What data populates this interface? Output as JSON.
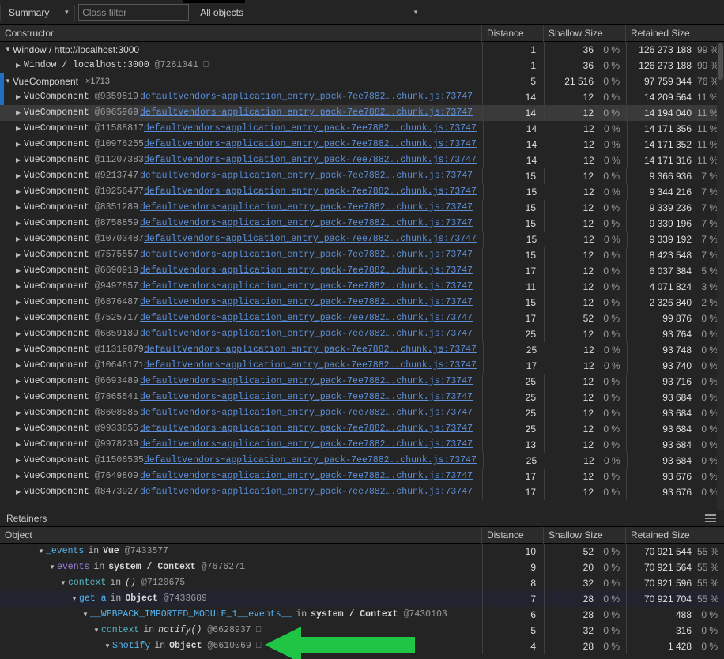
{
  "toolbar": {
    "view_select": "Summary",
    "view_caret": "chevron-down",
    "class_filter_placeholder": "Class filter",
    "class_filter_value": "",
    "objects_select": "All objects",
    "objects_caret": "chevron-down"
  },
  "constructors_panel": {
    "columns": [
      "Constructor",
      "Distance",
      "Shallow Size",
      "Retained Size"
    ],
    "rows": [
      {
        "indent": 0,
        "tri": "open",
        "font": "sans",
        "name": "Window / http://localhost:3000",
        "at": "",
        "count": "",
        "link": "",
        "empty": false,
        "distance": "1",
        "shallow": "36",
        "shallow_pct": "0 %",
        "retained": "126 273 188",
        "retained_pct": "99 %",
        "state": ""
      },
      {
        "indent": 1,
        "tri": "closed",
        "font": "mono",
        "name": "Window / localhost:3000",
        "at": "@7261041",
        "count": "",
        "link": "",
        "empty": true,
        "distance": "1",
        "shallow": "36",
        "shallow_pct": "0 %",
        "retained": "126 273 188",
        "retained_pct": "99 %",
        "state": ""
      },
      {
        "indent": 0,
        "tri": "open",
        "font": "sans",
        "name": "VueComponent",
        "at": "",
        "count": "×1713",
        "link": "",
        "empty": false,
        "distance": "5",
        "shallow": "21 516",
        "shallow_pct": "0 %",
        "retained": "97 759 344",
        "retained_pct": "76 %",
        "state": ""
      },
      {
        "indent": 1,
        "tri": "closed",
        "font": "mono",
        "name": "VueComponent",
        "at": "@9359819",
        "count": "",
        "link": "defaultVendors~application_entry_pack-7ee7882….chunk.js:73747",
        "empty": false,
        "distance": "14",
        "shallow": "12",
        "shallow_pct": "0 %",
        "retained": "14 209 564",
        "retained_pct": "11 %",
        "state": ""
      },
      {
        "indent": 1,
        "tri": "closed",
        "font": "mono",
        "name": "VueComponent",
        "at": "@6965969",
        "count": "",
        "link": "defaultVendors~application_entry_pack-7ee7882….chunk.js:73747",
        "empty": false,
        "distance": "14",
        "shallow": "12",
        "shallow_pct": "0 %",
        "retained": "14 194 040",
        "retained_pct": "11 %",
        "state": "sel-gray"
      },
      {
        "indent": 1,
        "tri": "closed",
        "font": "mono",
        "name": "VueComponent",
        "at": "@11588817",
        "count": "",
        "link": "defaultVendors~application_entry_pack-7ee7882….chunk.js:73747",
        "empty": false,
        "distance": "14",
        "shallow": "12",
        "shallow_pct": "0 %",
        "retained": "14 171 356",
        "retained_pct": "11 %",
        "state": ""
      },
      {
        "indent": 1,
        "tri": "closed",
        "font": "mono",
        "name": "VueComponent",
        "at": "@10976255",
        "count": "",
        "link": "defaultVendors~application_entry_pack-7ee7882….chunk.js:73747",
        "empty": false,
        "distance": "14",
        "shallow": "12",
        "shallow_pct": "0 %",
        "retained": "14 171 352",
        "retained_pct": "11 %",
        "state": ""
      },
      {
        "indent": 1,
        "tri": "closed",
        "font": "mono",
        "name": "VueComponent",
        "at": "@11207383",
        "count": "",
        "link": "defaultVendors~application_entry_pack-7ee7882….chunk.js:73747",
        "empty": false,
        "distance": "14",
        "shallow": "12",
        "shallow_pct": "0 %",
        "retained": "14 171 316",
        "retained_pct": "11 %",
        "state": ""
      },
      {
        "indent": 1,
        "tri": "closed",
        "font": "mono",
        "name": "VueComponent",
        "at": "@9213747",
        "count": "",
        "link": "defaultVendors~application_entry_pack-7ee7882….chunk.js:73747",
        "empty": false,
        "distance": "15",
        "shallow": "12",
        "shallow_pct": "0 %",
        "retained": "9 366 936",
        "retained_pct": "7 %",
        "state": ""
      },
      {
        "indent": 1,
        "tri": "closed",
        "font": "mono",
        "name": "VueComponent",
        "at": "@10256477",
        "count": "",
        "link": "defaultVendors~application_entry_pack-7ee7882….chunk.js:73747",
        "empty": false,
        "distance": "15",
        "shallow": "12",
        "shallow_pct": "0 %",
        "retained": "9 344 216",
        "retained_pct": "7 %",
        "state": ""
      },
      {
        "indent": 1,
        "tri": "closed",
        "font": "mono",
        "name": "VueComponent",
        "at": "@8351289",
        "count": "",
        "link": "defaultVendors~application_entry_pack-7ee7882….chunk.js:73747",
        "empty": false,
        "distance": "15",
        "shallow": "12",
        "shallow_pct": "0 %",
        "retained": "9 339 236",
        "retained_pct": "7 %",
        "state": ""
      },
      {
        "indent": 1,
        "tri": "closed",
        "font": "mono",
        "name": "VueComponent",
        "at": "@8758859",
        "count": "",
        "link": "defaultVendors~application_entry_pack-7ee7882….chunk.js:73747",
        "empty": false,
        "distance": "15",
        "shallow": "12",
        "shallow_pct": "0 %",
        "retained": "9 339 196",
        "retained_pct": "7 %",
        "state": ""
      },
      {
        "indent": 1,
        "tri": "closed",
        "font": "mono",
        "name": "VueComponent",
        "at": "@10703487",
        "count": "",
        "link": "defaultVendors~application_entry_pack-7ee7882….chunk.js:73747",
        "empty": false,
        "distance": "15",
        "shallow": "12",
        "shallow_pct": "0 %",
        "retained": "9 339 192",
        "retained_pct": "7 %",
        "state": ""
      },
      {
        "indent": 1,
        "tri": "closed",
        "font": "mono",
        "name": "VueComponent",
        "at": "@7575557",
        "count": "",
        "link": "defaultVendors~application_entry_pack-7ee7882….chunk.js:73747",
        "empty": false,
        "distance": "15",
        "shallow": "12",
        "shallow_pct": "0 %",
        "retained": "8 423 548",
        "retained_pct": "7 %",
        "state": ""
      },
      {
        "indent": 1,
        "tri": "closed",
        "font": "mono",
        "name": "VueComponent",
        "at": "@6690919",
        "count": "",
        "link": "defaultVendors~application_entry_pack-7ee7882….chunk.js:73747",
        "empty": false,
        "distance": "17",
        "shallow": "12",
        "shallow_pct": "0 %",
        "retained": "6 037 384",
        "retained_pct": "5 %",
        "state": ""
      },
      {
        "indent": 1,
        "tri": "closed",
        "font": "mono",
        "name": "VueComponent",
        "at": "@9497857",
        "count": "",
        "link": "defaultVendors~application_entry_pack-7ee7882….chunk.js:73747",
        "empty": false,
        "distance": "11",
        "shallow": "12",
        "shallow_pct": "0 %",
        "retained": "4 071 824",
        "retained_pct": "3 %",
        "state": ""
      },
      {
        "indent": 1,
        "tri": "closed",
        "font": "mono",
        "name": "VueComponent",
        "at": "@6876487",
        "count": "",
        "link": "defaultVendors~application_entry_pack-7ee7882….chunk.js:73747",
        "empty": false,
        "distance": "15",
        "shallow": "12",
        "shallow_pct": "0 %",
        "retained": "2 326 840",
        "retained_pct": "2 %",
        "state": ""
      },
      {
        "indent": 1,
        "tri": "closed",
        "font": "mono",
        "name": "VueComponent",
        "at": "@7525717",
        "count": "",
        "link": "defaultVendors~application_entry_pack-7ee7882….chunk.js:73747",
        "empty": false,
        "distance": "17",
        "shallow": "52",
        "shallow_pct": "0 %",
        "retained": "99 876",
        "retained_pct": "0 %",
        "state": ""
      },
      {
        "indent": 1,
        "tri": "closed",
        "font": "mono",
        "name": "VueComponent",
        "at": "@6859189",
        "count": "",
        "link": "defaultVendors~application_entry_pack-7ee7882….chunk.js:73747",
        "empty": false,
        "distance": "25",
        "shallow": "12",
        "shallow_pct": "0 %",
        "retained": "93 764",
        "retained_pct": "0 %",
        "state": ""
      },
      {
        "indent": 1,
        "tri": "closed",
        "font": "mono",
        "name": "VueComponent",
        "at": "@11319879",
        "count": "",
        "link": "defaultVendors~application_entry_pack-7ee7882….chunk.js:73747",
        "empty": false,
        "distance": "25",
        "shallow": "12",
        "shallow_pct": "0 %",
        "retained": "93 748",
        "retained_pct": "0 %",
        "state": ""
      },
      {
        "indent": 1,
        "tri": "closed",
        "font": "mono",
        "name": "VueComponent",
        "at": "@10646171",
        "count": "",
        "link": "defaultVendors~application_entry_pack-7ee7882….chunk.js:73747",
        "empty": false,
        "distance": "17",
        "shallow": "12",
        "shallow_pct": "0 %",
        "retained": "93 740",
        "retained_pct": "0 %",
        "state": ""
      },
      {
        "indent": 1,
        "tri": "closed",
        "font": "mono",
        "name": "VueComponent",
        "at": "@6693489",
        "count": "",
        "link": "defaultVendors~application_entry_pack-7ee7882….chunk.js:73747",
        "empty": false,
        "distance": "25",
        "shallow": "12",
        "shallow_pct": "0 %",
        "retained": "93 716",
        "retained_pct": "0 %",
        "state": ""
      },
      {
        "indent": 1,
        "tri": "closed",
        "font": "mono",
        "name": "VueComponent",
        "at": "@7865541",
        "count": "",
        "link": "defaultVendors~application_entry_pack-7ee7882….chunk.js:73747",
        "empty": false,
        "distance": "25",
        "shallow": "12",
        "shallow_pct": "0 %",
        "retained": "93 684",
        "retained_pct": "0 %",
        "state": ""
      },
      {
        "indent": 1,
        "tri": "closed",
        "font": "mono",
        "name": "VueComponent",
        "at": "@8608585",
        "count": "",
        "link": "defaultVendors~application_entry_pack-7ee7882….chunk.js:73747",
        "empty": false,
        "distance": "25",
        "shallow": "12",
        "shallow_pct": "0 %",
        "retained": "93 684",
        "retained_pct": "0 %",
        "state": ""
      },
      {
        "indent": 1,
        "tri": "closed",
        "font": "mono",
        "name": "VueComponent",
        "at": "@9933855",
        "count": "",
        "link": "defaultVendors~application_entry_pack-7ee7882….chunk.js:73747",
        "empty": false,
        "distance": "25",
        "shallow": "12",
        "shallow_pct": "0 %",
        "retained": "93 684",
        "retained_pct": "0 %",
        "state": ""
      },
      {
        "indent": 1,
        "tri": "closed",
        "font": "mono",
        "name": "VueComponent",
        "at": "@9978239",
        "count": "",
        "link": "defaultVendors~application_entry_pack-7ee7882….chunk.js:73747",
        "empty": false,
        "distance": "13",
        "shallow": "12",
        "shallow_pct": "0 %",
        "retained": "93 684",
        "retained_pct": "0 %",
        "state": ""
      },
      {
        "indent": 1,
        "tri": "closed",
        "font": "mono",
        "name": "VueComponent",
        "at": "@11506535",
        "count": "",
        "link": "defaultVendors~application_entry_pack-7ee7882….chunk.js:73747",
        "empty": false,
        "distance": "25",
        "shallow": "12",
        "shallow_pct": "0 %",
        "retained": "93 684",
        "retained_pct": "0 %",
        "state": ""
      },
      {
        "indent": 1,
        "tri": "closed",
        "font": "mono",
        "name": "VueComponent",
        "at": "@7649809",
        "count": "",
        "link": "defaultVendors~application_entry_pack-7ee7882….chunk.js:73747",
        "empty": false,
        "distance": "17",
        "shallow": "12",
        "shallow_pct": "0 %",
        "retained": "93 676",
        "retained_pct": "0 %",
        "state": ""
      },
      {
        "indent": 1,
        "tri": "closed",
        "font": "mono",
        "name": "VueComponent",
        "at": "@8473927",
        "count": "",
        "link": "defaultVendors~application_entry_pack-7ee7882….chunk.js:73747",
        "empty": false,
        "distance": "17",
        "shallow": "12",
        "shallow_pct": "0 %",
        "retained": "93 676",
        "retained_pct": "0 %",
        "state": ""
      }
    ]
  },
  "retainers_panel": {
    "title": "Retainers",
    "resize_grip": "resize-grip",
    "columns": [
      "Object",
      "Distance",
      "Shallow Size",
      "Retained Size"
    ],
    "rows": [
      {
        "indent": 3,
        "tri": "open",
        "prop": "_events",
        "prop_color": "prop-blue",
        "in": "in",
        "holder": "Vue",
        "holder_style": "holder",
        "at": "@7433577",
        "empty": false,
        "distance": "10",
        "shallow": "52",
        "shallow_pct": "0 %",
        "retained": "70 921 544",
        "retained_pct": "55 %",
        "state": ""
      },
      {
        "indent": 4,
        "tri": "open",
        "prop": "events",
        "prop_color": "prop-purple",
        "in": "in",
        "holder": "system / Context",
        "holder_style": "holder",
        "at": "@7676271",
        "empty": false,
        "distance": "9",
        "shallow": "20",
        "shallow_pct": "0 %",
        "retained": "70 921 564",
        "retained_pct": "55 %",
        "state": ""
      },
      {
        "indent": 5,
        "tri": "open",
        "prop": "context",
        "prop_color": "prop-teal",
        "in": "in",
        "holder": "()",
        "holder_style": "holder-it",
        "at": "@7120675",
        "empty": false,
        "distance": "8",
        "shallow": "32",
        "shallow_pct": "0 %",
        "retained": "70 921 596",
        "retained_pct": "55 %",
        "state": ""
      },
      {
        "indent": 6,
        "tri": "open",
        "prop": "get a",
        "prop_color": "prop-blue",
        "in": "in",
        "holder": "Object",
        "holder_style": "holder",
        "at": "@7433689",
        "empty": false,
        "distance": "7",
        "shallow": "28",
        "shallow_pct": "0 %",
        "retained": "70 921 704",
        "retained_pct": "55 %",
        "state": "sel-blue"
      },
      {
        "indent": 7,
        "tri": "open",
        "prop": "__WEBPACK_IMPORTED_MODULE_1__events__",
        "prop_color": "prop-blue",
        "in": "in",
        "holder": "system / Context",
        "holder_style": "holder",
        "at": "@7430103",
        "empty": false,
        "distance": "6",
        "shallow": "28",
        "shallow_pct": "0 %",
        "retained": "488",
        "retained_pct": "0 %",
        "state": ""
      },
      {
        "indent": 8,
        "tri": "open",
        "prop": "context",
        "prop_color": "prop-teal",
        "in": "in",
        "holder": "notify()",
        "holder_style": "holder-it",
        "at": "@6628937",
        "empty": true,
        "distance": "5",
        "shallow": "32",
        "shallow_pct": "0 %",
        "retained": "316",
        "retained_pct": "0 %",
        "state": ""
      },
      {
        "indent": 9,
        "tri": "open",
        "prop": "$notify",
        "prop_color": "prop-blue",
        "in": "in",
        "holder": "Object",
        "holder_style": "holder",
        "at": "@6610069",
        "empty": true,
        "distance": "4",
        "shallow": "28",
        "shallow_pct": "0 %",
        "retained": "1 428",
        "retained_pct": "0 %",
        "state": ""
      }
    ]
  },
  "annotation": {
    "arrow": "green-left-arrow",
    "arrow_color": "#21c545"
  }
}
